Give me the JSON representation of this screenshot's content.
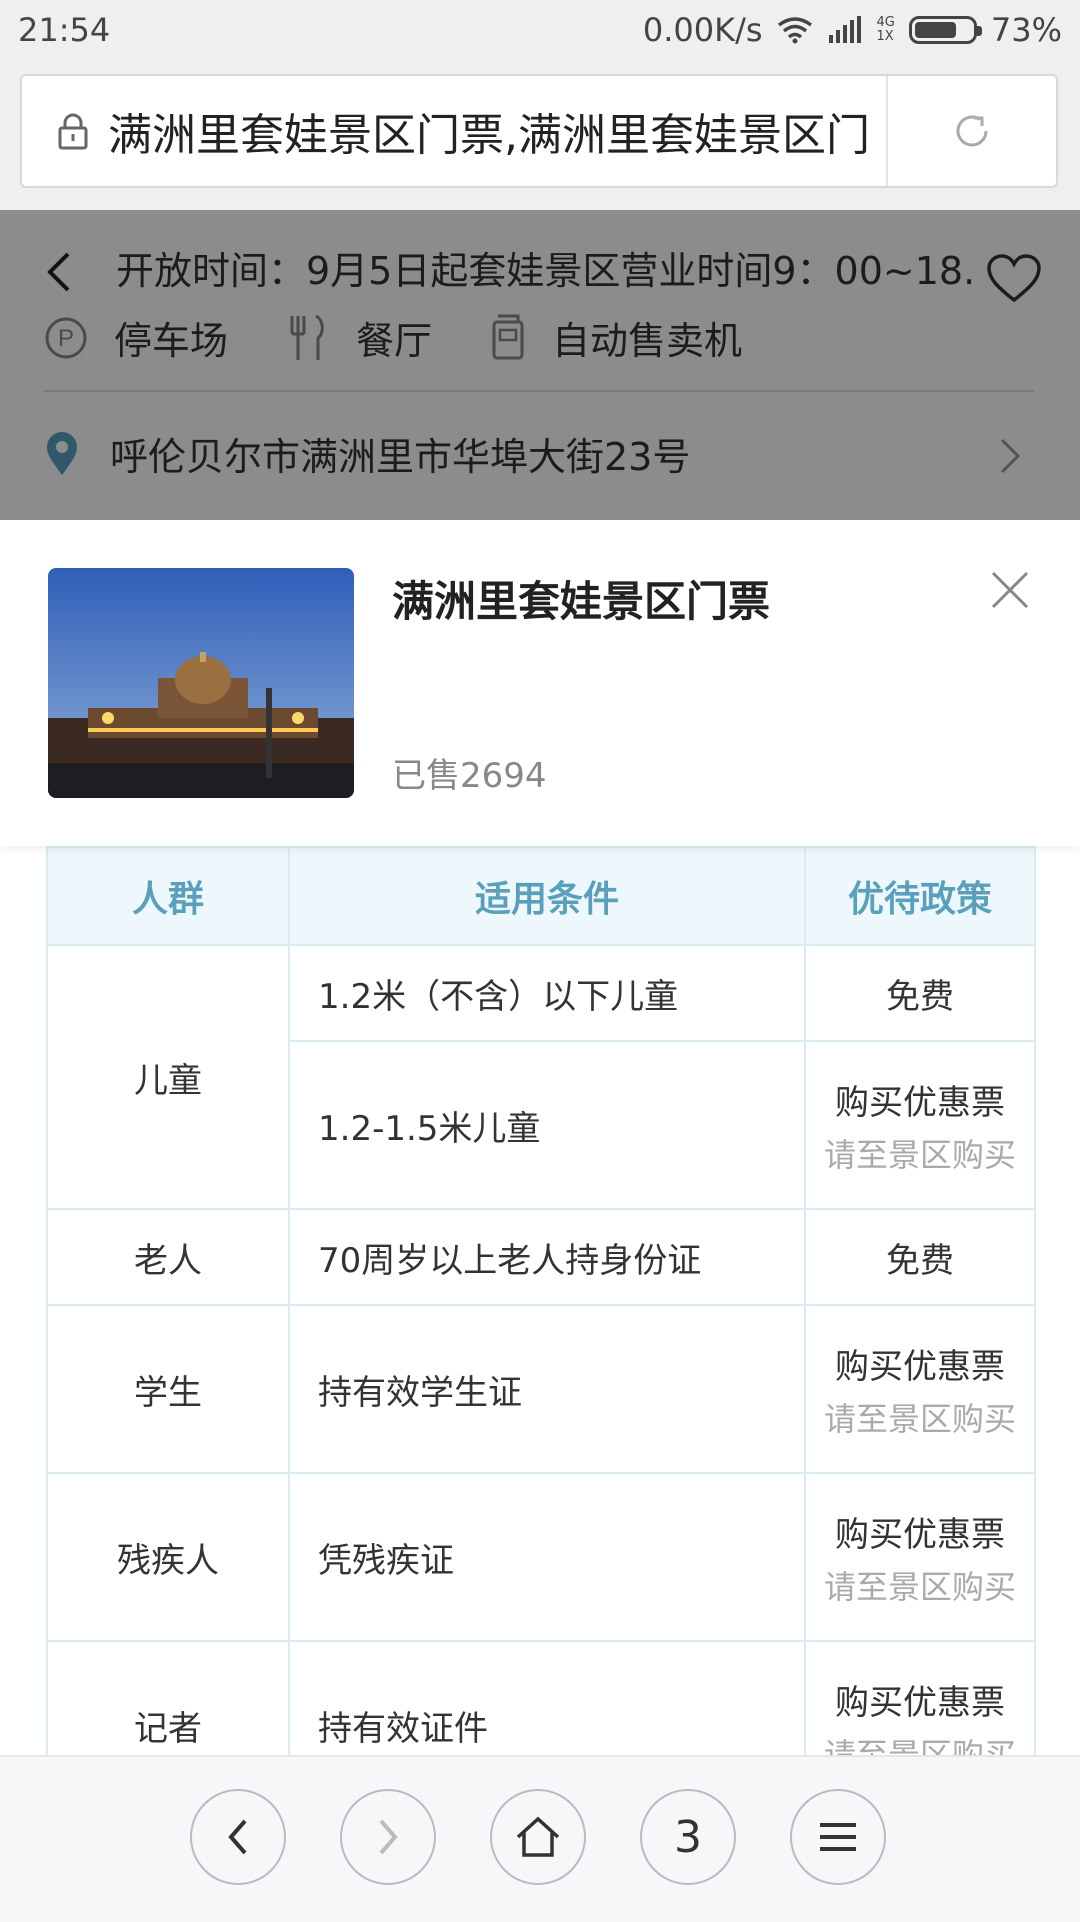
{
  "status": {
    "time": "21:54",
    "speed": "0.00K/s",
    "net_top": "4G",
    "net_bottom": "1X",
    "battery": "73%",
    "battery_level": 0.73
  },
  "browser": {
    "url": "满洲里套娃景区门票,满洲里套娃景区门",
    "reload_icon": "refresh-icon",
    "lock_icon": "lock-icon"
  },
  "background_page": {
    "open_hours": "开放时间：9月5日起套娃景区营业时间9：00~18...",
    "facilities": [
      {
        "icon": "parking-icon",
        "label": "停车场"
      },
      {
        "icon": "restaurant-icon",
        "label": "餐厅"
      },
      {
        "icon": "vending-machine-icon",
        "label": "自动售卖机"
      }
    ],
    "address": "呼伦贝尔市满洲里市华埠大街23号"
  },
  "product": {
    "title": "满洲里套娃景区门票",
    "sold": "已售2694"
  },
  "table": {
    "headers": [
      "人群",
      "适用条件",
      "优待政策"
    ],
    "rows": [
      {
        "group": "儿童",
        "cond": "1.2米（不含）以下儿童",
        "policy": "免费",
        "note": ""
      },
      {
        "group": "",
        "cond": "1.2-1.5米儿童",
        "policy": "购买优惠票",
        "note": "请至景区购买"
      },
      {
        "group": "老人",
        "cond": "70周岁以上老人持身份证",
        "policy": "免费",
        "note": ""
      },
      {
        "group": "学生",
        "cond": "持有效学生证",
        "policy": "购买优惠票",
        "note": "请至景区购买"
      },
      {
        "group": "残疾人",
        "cond": "凭残疾证",
        "policy": "购买优惠票",
        "note": "请至景区购买"
      },
      {
        "group": "记者",
        "cond": "持有效证件",
        "policy": "购买优惠票",
        "note": "请至景区购买"
      }
    ]
  },
  "nav": {
    "tabs_count": "3"
  },
  "colors": {
    "header_text": "#5aa0bd",
    "header_bg": "#eef8fc",
    "border": "#d8eaf2"
  }
}
